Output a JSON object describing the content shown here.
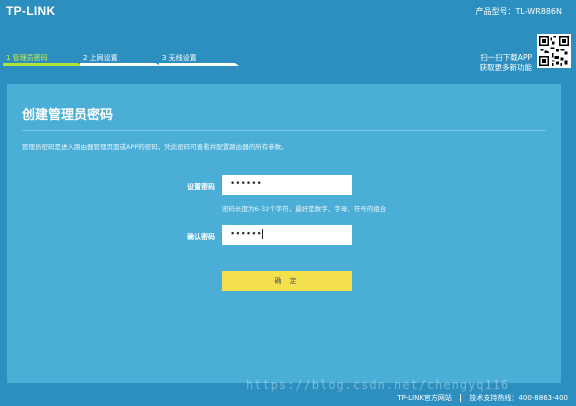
{
  "header": {
    "logo": "TP-LINK",
    "model": "产品型号：TL-WR886N",
    "steps": [
      {
        "label": "1 管理员密码",
        "active": true
      },
      {
        "label": "2 上网设置",
        "active": false
      },
      {
        "label": "3 无线设置",
        "active": false
      }
    ],
    "app_line1": "扫一扫下载APP",
    "app_line2": "获取更多新功能"
  },
  "panel": {
    "title": "创建管理员密码",
    "description": "管理员密码是进入路由器管理页面或APP的密码，凭此密码可查看并配置路由器的所有参数。",
    "password_label": "设置密码",
    "password_value": "••••••",
    "hint": "密码长度为6-32个字符，最好是数字、字母、符号的组合",
    "confirm_label": "确认密码",
    "confirm_value": "••••••",
    "submit_label": "确 定"
  },
  "footer": {
    "site": "TP-LINK官方网站",
    "support": "技术支持热线：400-8863-400"
  },
  "watermark": "https://blog.csdn.net/chengyq116",
  "colors": {
    "background": "#2d8fbf",
    "panel": "#4aaed6",
    "active_step": "#b4e23a",
    "button": "#f4e04d"
  }
}
